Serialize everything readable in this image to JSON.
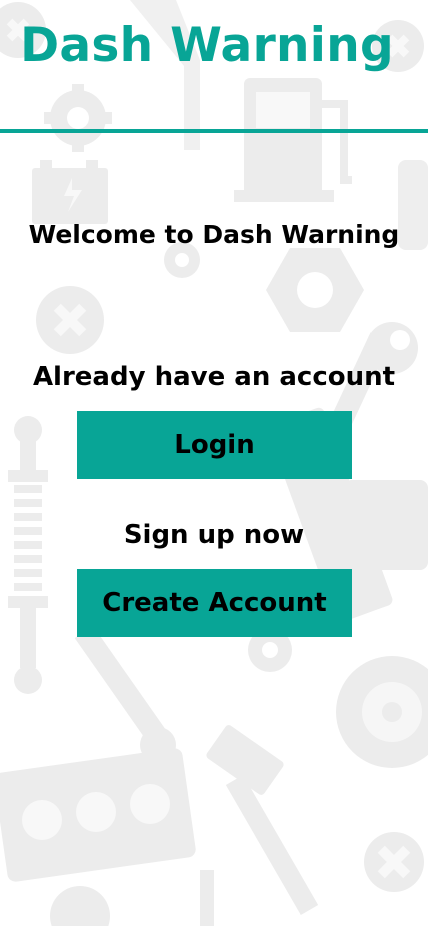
{
  "app": {
    "title": "Dash Warning"
  },
  "welcome_text": "Welcome to Dash Warning",
  "login_section": {
    "prompt": "Already have an account",
    "button_label": "Login"
  },
  "signup_section": {
    "prompt": "Sign up now",
    "button_label": "Create Account"
  },
  "colors": {
    "accent": "#08a596",
    "background": "#ffffff",
    "text": "#000000",
    "pattern": "#ececec"
  },
  "background_icons": [
    "gear-icon",
    "fuel-pump-icon",
    "battery-icon",
    "screw-icon",
    "nut-icon",
    "shock-absorber-icon",
    "wrench-icon",
    "piston-icon",
    "brake-disc-icon",
    "engine-block-icon",
    "spark-plug-icon"
  ]
}
